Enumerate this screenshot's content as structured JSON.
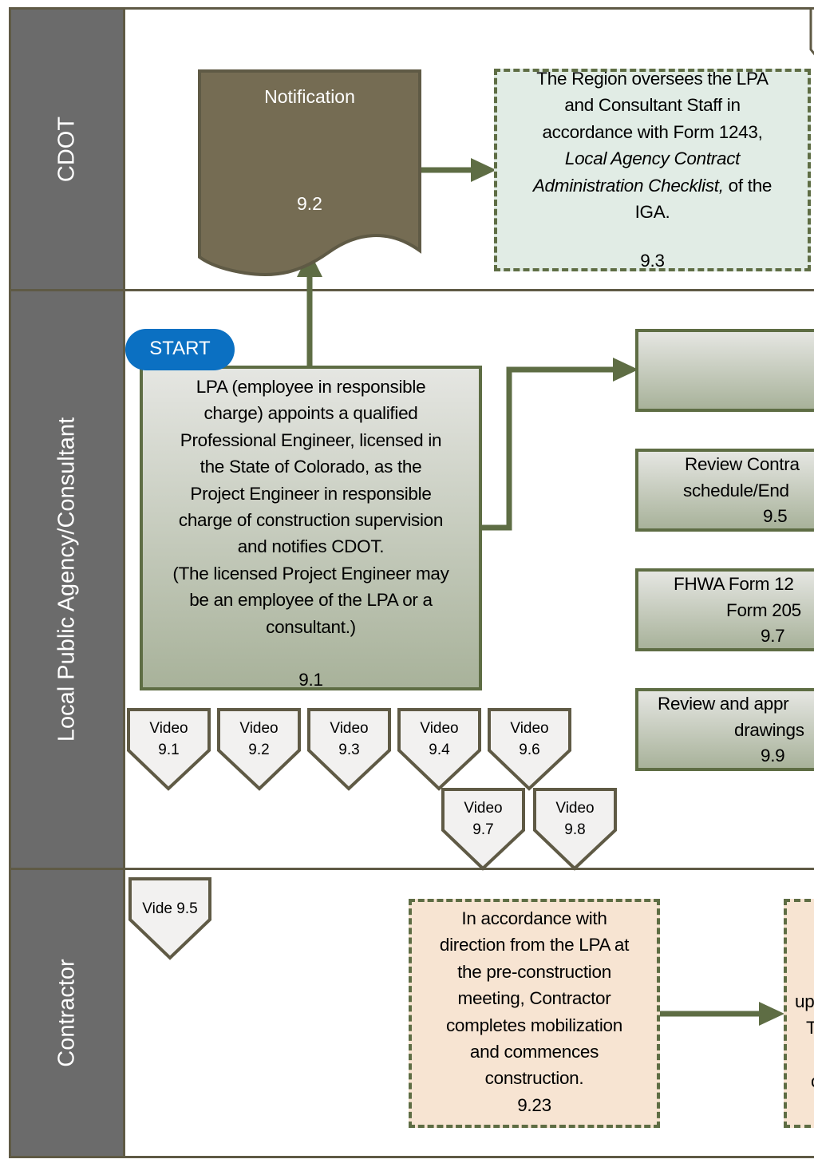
{
  "lanes": [
    {
      "label": "CDOT"
    },
    {
      "label": "Local Public Agency/Consultant"
    },
    {
      "label": "Contractor"
    }
  ],
  "notification": {
    "title": "Notification",
    "step": "9.2"
  },
  "step_9_3": {
    "line1": "The Region oversees the LPA",
    "line2": "and Consultant Staff in",
    "line3": "accordance with Form 1243,",
    "line4_italic": "Local Agency Contract",
    "line5_italic": "Administration Checklist,",
    "line5_rest": " of the",
    "line6": "IGA.",
    "step": "9.3"
  },
  "start": {
    "label": "START"
  },
  "step_9_1": {
    "lines": [
      "LPA (employee in responsible",
      "charge) appoints a qualified",
      "Professional Engineer, licensed in",
      "the State of Colorado, as the",
      "Project Engineer in responsible",
      "charge of construction supervision",
      "and notifies CDOT.",
      "(The licensed Project Engineer may",
      "be an employee of the LPA or a",
      "consultant.)"
    ],
    "step": "9.1"
  },
  "step_9_4": {
    "text": ""
  },
  "step_9_5": {
    "line1": "Review Contra",
    "line2": "schedule/End",
    "step": "9.5"
  },
  "step_9_7": {
    "line1": "FHWA Form 12",
    "line2": "Form 205",
    "step": "9.7"
  },
  "step_9_9": {
    "line1": "Review and appr",
    "line2": "drawings",
    "step": "9.9"
  },
  "videos": [
    {
      "label": "Video",
      "num": "9.1"
    },
    {
      "label": "Video",
      "num": "9.2"
    },
    {
      "label": "Video",
      "num": "9.3"
    },
    {
      "label": "Video",
      "num": "9.4"
    },
    {
      "label": "Video",
      "num": "9.6"
    },
    {
      "label": "Video",
      "num": "9.7"
    },
    {
      "label": "Video",
      "num": "9.8"
    }
  ],
  "video_9_5": {
    "label": "Vide 9.5"
  },
  "step_9_23": {
    "lines": [
      "In accordance with",
      "direction from the LPA at",
      "the pre-construction",
      "meeting, Contractor",
      "completes mobilization",
      "and  commences",
      "construction."
    ],
    "step": "9.23"
  },
  "step_9_24": {
    "frag1": "up",
    "frag2": "T",
    "frag3": "c"
  },
  "colors": {
    "lane_header": "#6b6b6b",
    "border": "#5f5a45",
    "arrow": "#5e6d44",
    "start": "#0b70c2",
    "notification": "#756c53",
    "cdot_box": "#e1ece5",
    "contractor_box": "#f7e4d2"
  }
}
